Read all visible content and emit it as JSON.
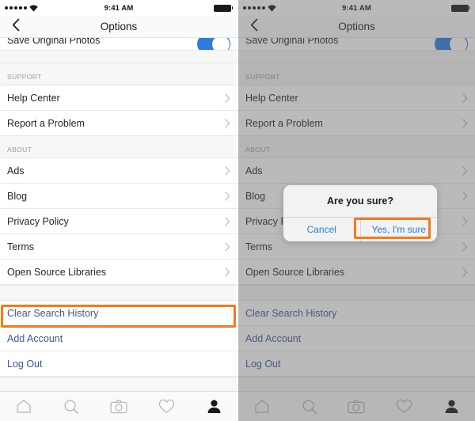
{
  "status_bar": {
    "signal_dots": 5,
    "wifi_icon": "wifi-icon",
    "time": "9:41 AM",
    "battery_icon": "battery-full-icon"
  },
  "nav": {
    "back_icon": "chevron-left-icon",
    "title": "Options"
  },
  "list": {
    "partial_row": {
      "label": "Save Original Photos",
      "toggle_on": true
    },
    "sections": [
      {
        "header": "SUPPORT",
        "rows": [
          {
            "label": "Help Center",
            "accessory": "chevron-right-icon"
          },
          {
            "label": "Report a Problem",
            "accessory": "chevron-right-icon"
          }
        ]
      },
      {
        "header": "ABOUT",
        "rows": [
          {
            "label": "Ads",
            "accessory": "chevron-right-icon"
          },
          {
            "label": "Blog",
            "accessory": "chevron-right-icon"
          },
          {
            "label": "Privacy Policy",
            "accessory": "chevron-right-icon"
          },
          {
            "label": "Terms",
            "accessory": "chevron-right-icon"
          },
          {
            "label": "Open Source Libraries",
            "accessory": "chevron-right-icon"
          }
        ]
      },
      {
        "header": "",
        "rows": [
          {
            "label": "Clear Search History",
            "accessory": ""
          },
          {
            "label": "Add Account",
            "accessory": ""
          },
          {
            "label": "Log Out",
            "accessory": ""
          }
        ]
      }
    ]
  },
  "tabbar": {
    "items": [
      {
        "icon": "home-icon",
        "active": false
      },
      {
        "icon": "search-icon",
        "active": false
      },
      {
        "icon": "camera-icon",
        "active": false
      },
      {
        "icon": "heart-icon",
        "active": false
      },
      {
        "icon": "profile-icon",
        "active": true
      }
    ]
  },
  "dialog": {
    "title": "Are you sure?",
    "cancel_label": "Cancel",
    "confirm_label": "Yes, I'm sure"
  },
  "highlights": {
    "left_target": "Clear Search History",
    "right_target": "Yes, I'm sure",
    "color": "#f07c1d"
  },
  "colors": {
    "accent_link": "#3b5998",
    "dialog_button": "#2b7ae0",
    "toggle_on": "#2f7ce0",
    "highlight": "#f07c1d",
    "dim_overlay": "#9a9a9a",
    "section_bg": "#f7f7f7"
  }
}
